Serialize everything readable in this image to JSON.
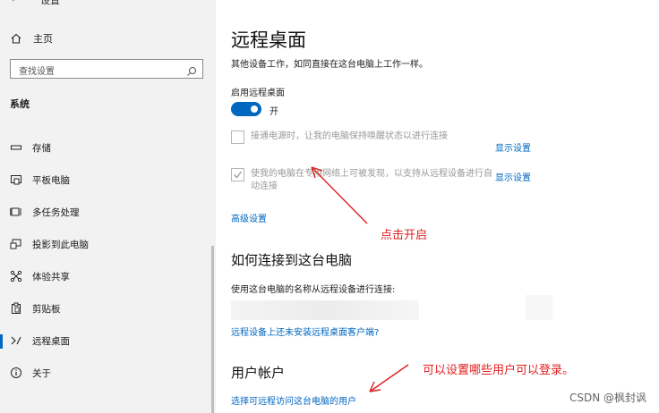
{
  "sidebar": {
    "back_glyph": "‹",
    "window_title": "设置",
    "home_label": "主页",
    "search_placeholder": "查找设置",
    "section_label": "系统",
    "items": [
      {
        "label": "存储",
        "icon": "storage-icon"
      },
      {
        "label": "平板电脑",
        "icon": "tablet-icon"
      },
      {
        "label": "多任务处理",
        "icon": "multitasking-icon"
      },
      {
        "label": "投影到此电脑",
        "icon": "projecting-icon"
      },
      {
        "label": "体验共享",
        "icon": "shared-experiences-icon"
      },
      {
        "label": "剪贴板",
        "icon": "clipboard-icon"
      },
      {
        "label": "远程桌面",
        "icon": "remote-desktop-icon",
        "active": true
      },
      {
        "label": "关于",
        "icon": "info-icon"
      }
    ]
  },
  "main": {
    "title": "远程桌面",
    "description": "其他设备工作，如同直接在这台电脑上工作一样。",
    "enable_label": "启用远程桌面",
    "toggle_state": "开",
    "toggle_on": true,
    "option1": {
      "text": "接通电源时，让我的电脑保持唤醒状态以进行连接",
      "checked": false,
      "link": "显示设置"
    },
    "option2": {
      "text": "使我的电脑在专用网络上可被发现，以支持从远程设备进行自动连接",
      "checked": true,
      "link": "显示设置"
    },
    "advanced_link": "高级设置",
    "how_to_heading": "如何连接到这台电脑",
    "how_to_text": "使用这台电脑的名称从远程设备进行连接:",
    "client_link": "远程设备上还未安装远程桌面客户端?",
    "accounts_heading": "用户帐户",
    "accounts_link": "选择可远程访问这台电脑的用户"
  },
  "annotations": {
    "click_enable": "点击开启",
    "set_users": "可以设置哪些用户可以登录。",
    "color": "#e02020"
  },
  "watermark": "CSDN @枫封讽",
  "colors": {
    "accent": "#0067c0",
    "sidebar_bg": "#f2f2f2"
  }
}
